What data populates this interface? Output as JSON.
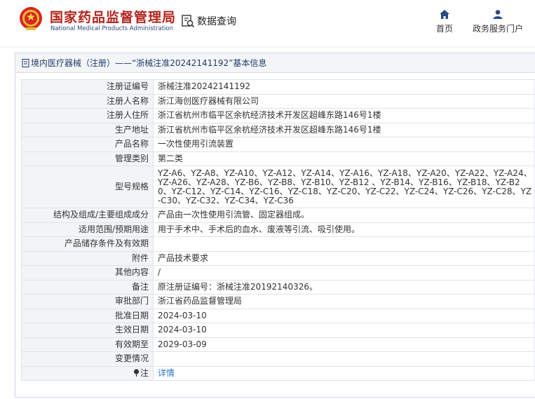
{
  "header": {
    "org_name_cn": "国家药品监督管理局",
    "org_name_en": "National Medical Products Administration",
    "query_label": "数据查询",
    "nav": [
      {
        "label": "首页",
        "icon": "home-icon"
      },
      {
        "label": "政务服务门户",
        "icon": "user-icon"
      }
    ]
  },
  "panel": {
    "breadcrumb": "境内医疗器械（注册）——“浙械注准20242141192”基本信息"
  },
  "rows": [
    {
      "key": "注册证编号",
      "value": "浙械注准20242141192"
    },
    {
      "key": "注册人名称",
      "value": "浙江海创医疗器械有限公司"
    },
    {
      "key": "注册人住所",
      "value": "浙江省杭州市临平区余杭经济技术开发区超峰东路146号1楼"
    },
    {
      "key": "生产地址",
      "value": "浙江省杭州市临平区余杭经济技术开发区超峰东路146号1楼"
    },
    {
      "key": "产品名称",
      "value": "一次性使用引流装置"
    },
    {
      "key": "管理类别",
      "value": "第二类"
    },
    {
      "key": "型号规格",
      "value": "YZ-A6、YZ-A8、YZ-A10、YZ-A12、YZ-A14、YZ-A16、YZ-A18、YZ-A20、YZ-A22、YZ-A24、YZ-A26、YZ-A28、YZ-B6、YZ-B8、YZ-B10、YZ-B12 、YZ-B14、YZ-B16、YZ-B18、YZ-B20、YZ-C12、YZ-C14、YZ-C16、YZ-C18、YZ-C20、YZ-C22、YZ-C24、YZ-C26、YZ-C28、YZ-C30、YZ-C32、YZ-C34、YZ-C36"
    },
    {
      "key": "结构及组成/主要组成成分",
      "value": "产品由一次性使用引流管、固定器组成。"
    },
    {
      "key": "适用范围/预期用途",
      "value": "用于手术中、手术后的血水、废液等引流、吸引使用。"
    },
    {
      "key": "产品储存条件及有效期",
      "value": ""
    },
    {
      "key": "附件",
      "value": "产品技术要求"
    },
    {
      "key": "其他内容",
      "value": "/"
    },
    {
      "key": "备注",
      "value": "原注册证编号：浙械注准20192140326。"
    },
    {
      "key": "审批部门",
      "value": "浙江省药品监督管理局"
    },
    {
      "key": "批准日期",
      "value": "2024-03-10"
    },
    {
      "key": "生效日期",
      "value": "2024-03-10"
    },
    {
      "key": "有效期至",
      "value": "2029-03-09"
    },
    {
      "key": "变更情况",
      "value": ""
    }
  ],
  "note_row": {
    "key": "注",
    "icon": "pin-icon",
    "link": "详情"
  }
}
